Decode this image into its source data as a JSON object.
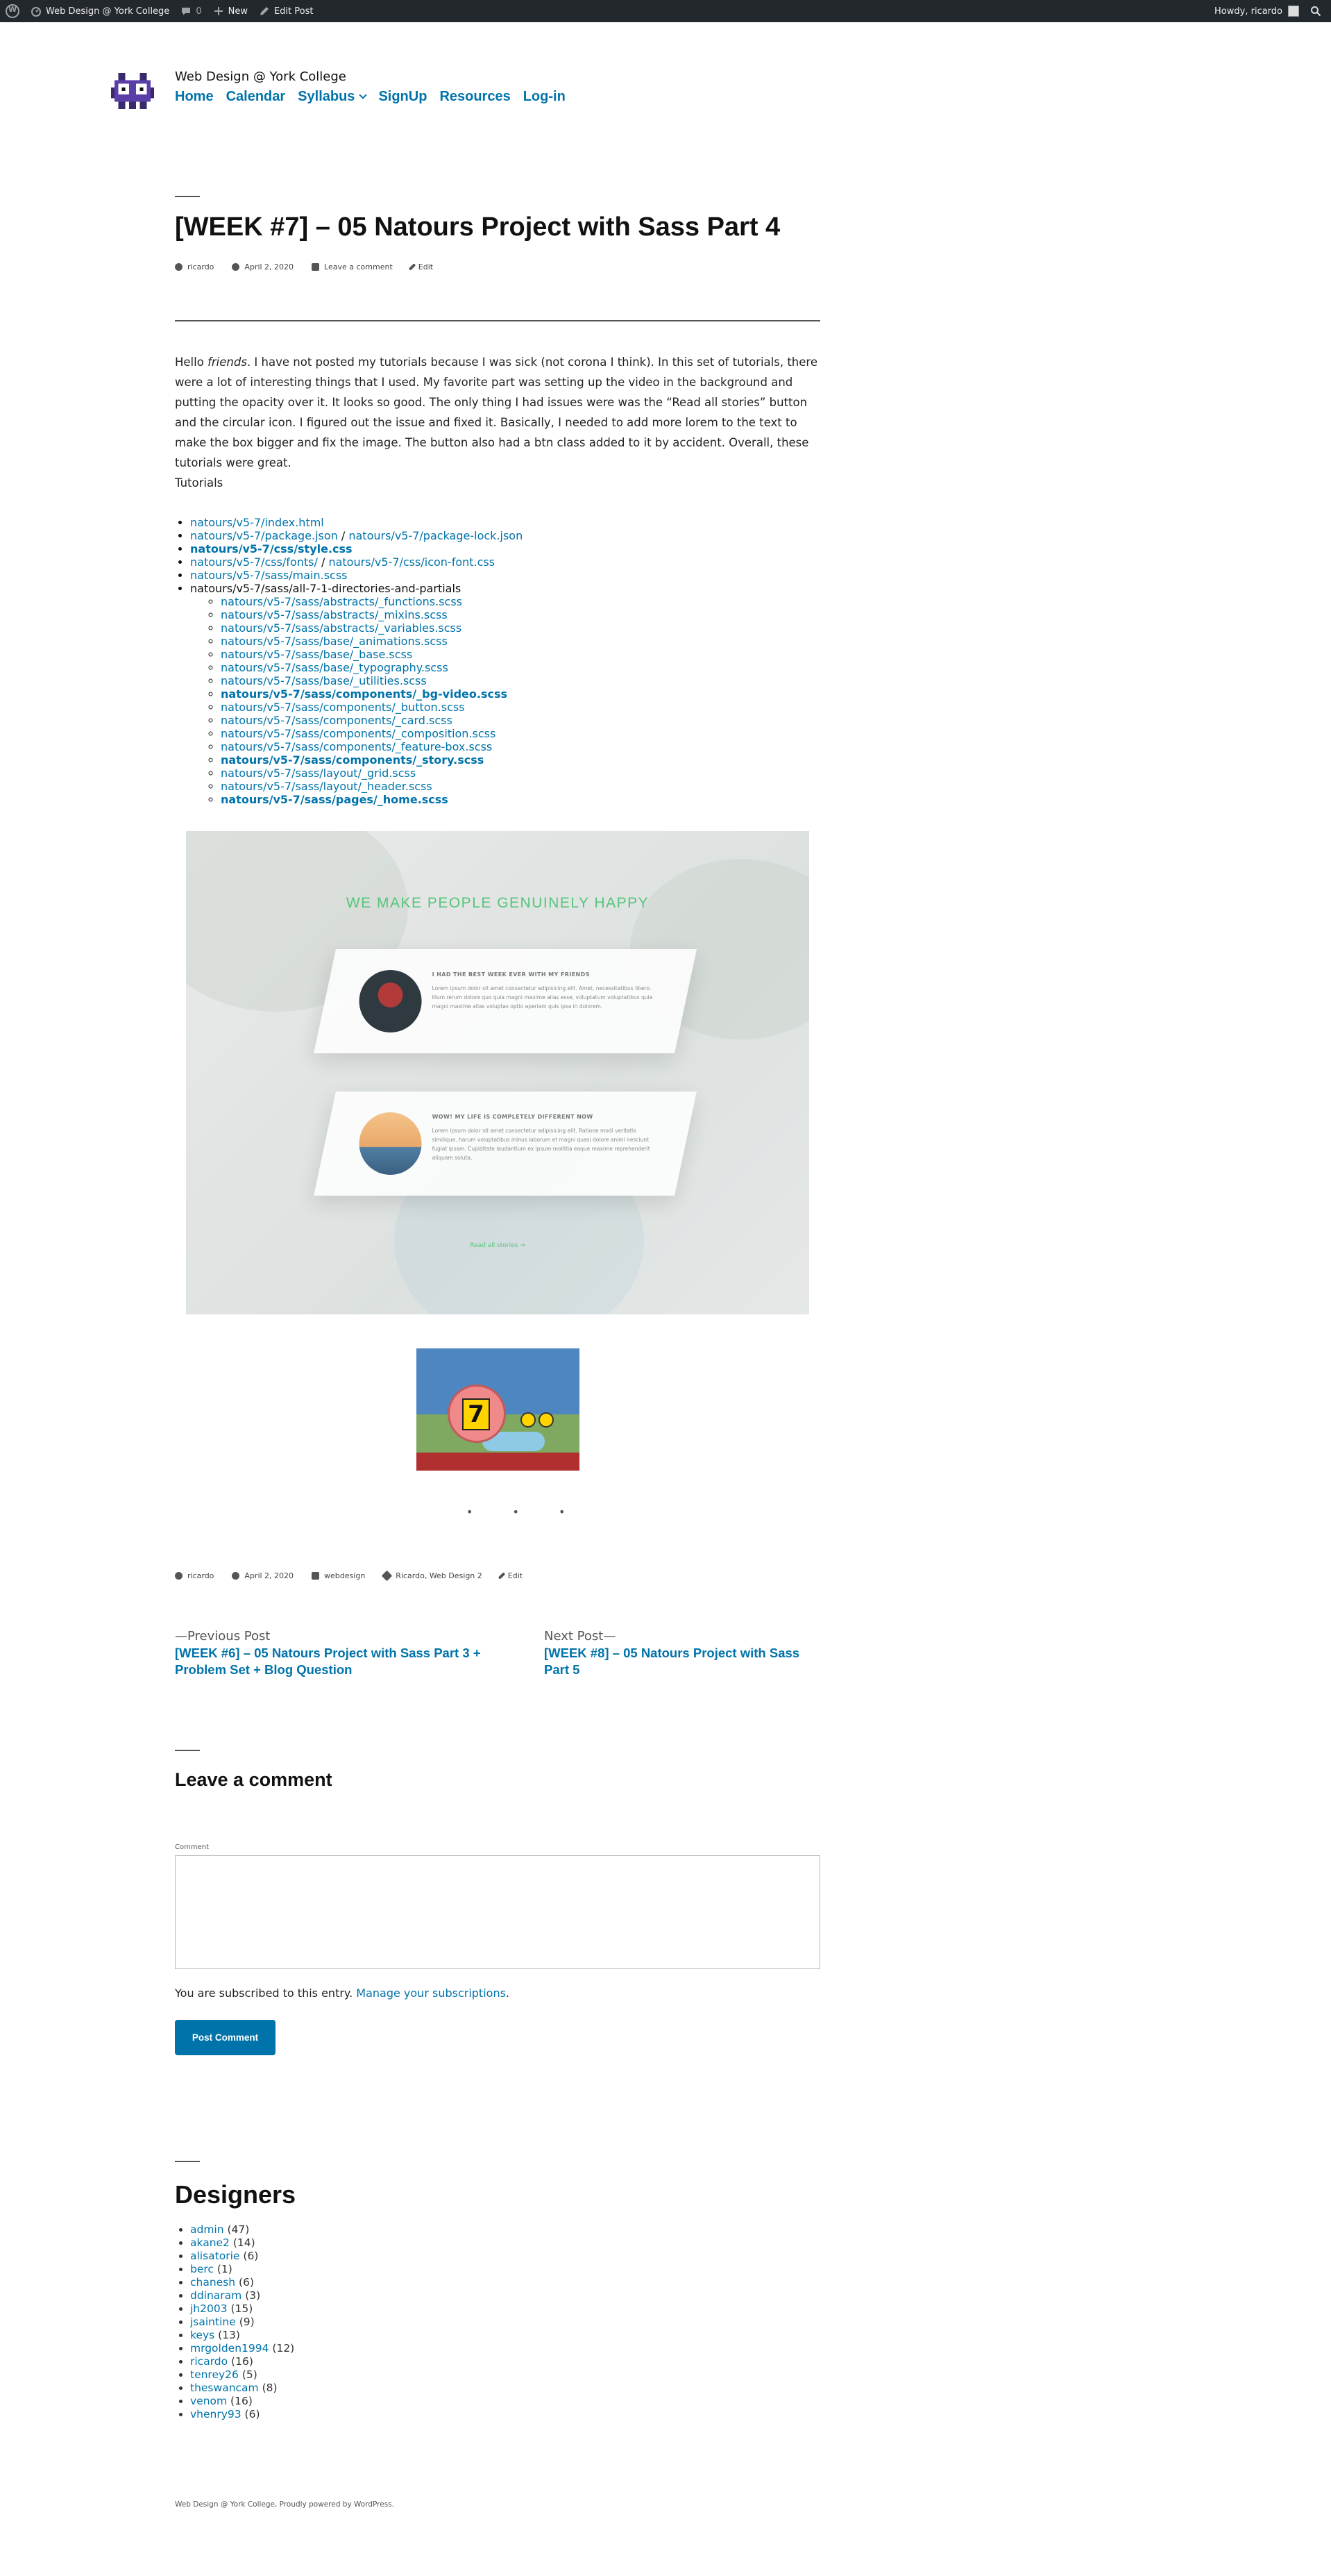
{
  "adminbar": {
    "site_name": "Web Design @ York College",
    "comments_count": "0",
    "new_label": "New",
    "edit_post_label": "Edit Post",
    "howdy": "Howdy, ricardo"
  },
  "header": {
    "site_title": "Web Design @ York College",
    "nav": [
      "Home",
      "Calendar",
      "Syllabus",
      "SignUp",
      "Resources",
      "Log-in"
    ]
  },
  "post": {
    "title": "[WEEK #7] – 05 Natours Project with Sass Part 4",
    "meta_top": {
      "author": "ricardo",
      "date": "April 2, 2020",
      "comment_link": "Leave a comment",
      "edit": "Edit"
    },
    "intro_before": "Hello ",
    "intro_em": "friends",
    "intro_after": ". I have not posted my tutorials because I was sick (not corona I think). In this set of tutorials, there were a lot of interesting things that I used. My favorite part was setting up the video in the background and putting the opacity over it. It looks so good. The only thing I had issues were was the “Read all stories” button and the circular icon. I figured out the issue and fixed it. Basically, I needed to add more lorem to the text to make the box bigger and fix the image. The button also had a btn class added to it by accident. Overall, these tutorials were great.",
    "tutorials_label": "Tutorials",
    "files": {
      "index": "natours/v5-7/index.html",
      "package": "natours/v5-7/package.json",
      "sep": " / ",
      "package_lock": "natours/v5-7/package-lock.json",
      "style": "natours/v5-7/css/style.css",
      "fonts": "natours/v5-7/css/fonts/",
      "icon_font": "natours/v5-7/css/icon-font.css",
      "main_scss": "natours/v5-7/sass/main.scss",
      "partials_label": "natours/v5-7/sass/all-7-1-directories-and-partials",
      "partials": [
        "natours/v5-7/sass/abstracts/_functions.scss",
        "natours/v5-7/sass/abstracts/_mixins.scss",
        "natours/v5-7/sass/abstracts/_variables.scss",
        "natours/v5-7/sass/base/_animations.scss",
        "natours/v5-7/sass/base/_base.scss",
        "natours/v5-7/sass/base/_typography.scss",
        "natours/v5-7/sass/base/_utilities.scss",
        "natours/v5-7/sass/components/_bg-video.scss",
        "natours/v5-7/sass/components/_button.scss",
        "natours/v5-7/sass/components/_card.scss",
        "natours/v5-7/sass/components/_composition.scss",
        "natours/v5-7/sass/components/_feature-box.scss",
        "natours/v5-7/sass/components/_story.scss",
        "natours/v5-7/sass/layout/_grid.scss",
        "natours/v5-7/sass/layout/_header.scss",
        "natours/v5-7/sass/pages/_home.scss"
      ]
    },
    "hero": {
      "heading": "WE MAKE PEOPLE GENUINELY HAPPY",
      "story1_title": "I HAD THE BEST WEEK EVER WITH MY FRIENDS",
      "story1_text": "Lorem ipsum dolor sit amet consectetur adipisicing elit. Amet, necessitatibus libero. Illum rerum dolore quo quia magni maxime alias esse, voluptatum voluptatibus quia magni maxime alias voluptas optio aperiam quis ipsa in dolorem.",
      "story2_title": "WOW! MY LIFE IS COMPLETELY DIFFERENT NOW",
      "story2_text": "Lorem ipsum dolor sit amet consectetur adipisicing elit. Ratione modi veritatis similique, harum voluptatibus minus laborum et magni quasi dolore animi nesciunt fugiat ipsam. Cupiditate laudantium ex ipsum mollitia eaque maxime reprehenderit aliquam soluta.",
      "read_all": "Read all stories →"
    },
    "snail_number": "7",
    "dots": "• • •",
    "meta_bottom": {
      "author": "ricardo",
      "date": "April 2, 2020",
      "category": "webdesign",
      "tags": "Ricardo, Web Design 2",
      "edit": "Edit"
    },
    "prev_label": "—Previous Post",
    "prev_title": "[WEEK #6] – 05 Natours Project with Sass Part 3 + Problem Set + Blog Question",
    "next_label": "Next Post—",
    "next_title": "[WEEK #8] – 05 Natours Project with Sass Part 5"
  },
  "comments": {
    "heading": "Leave a comment",
    "field_label": "Comment",
    "subscribed_text": "You are subscribed to this entry. ",
    "manage_link": "Manage your subscriptions",
    "period": ".",
    "submit_label": "Post Comment"
  },
  "designers": {
    "heading": "Designers",
    "list": [
      {
        "name": "admin",
        "count": " (47)"
      },
      {
        "name": "akane2",
        "count": " (14)"
      },
      {
        "name": "alisatorie",
        "count": " (6)"
      },
      {
        "name": "berc",
        "count": " (1)"
      },
      {
        "name": "chanesh",
        "count": " (6)"
      },
      {
        "name": "ddinaram",
        "count": " (3)"
      },
      {
        "name": "jh2003",
        "count": " (15)"
      },
      {
        "name": "jsaintine",
        "count": " (9)"
      },
      {
        "name": "keys",
        "count": " (13)"
      },
      {
        "name": "mrgolden1994",
        "count": " (12)"
      },
      {
        "name": "ricardo",
        "count": " (16)"
      },
      {
        "name": "tenrey26",
        "count": " (5)"
      },
      {
        "name": "theswancam",
        "count": " (8)"
      },
      {
        "name": "venom",
        "count": " (16)"
      },
      {
        "name": "vhenry93",
        "count": " (6)"
      }
    ]
  },
  "footer": {
    "text": "Web Design @ York College, Proudly powered by WordPress."
  }
}
